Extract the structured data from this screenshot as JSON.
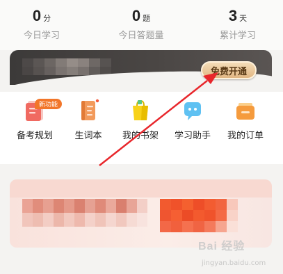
{
  "stats": [
    {
      "value": "0",
      "unit": "分",
      "label": "今日学习"
    },
    {
      "value": "0",
      "unit": "题",
      "label": "今日答题量"
    },
    {
      "value": "3",
      "unit": "天",
      "label": "累计学习"
    }
  ],
  "vip": {
    "button_label": "免费开通"
  },
  "tools": {
    "new_badge": "新功能",
    "items": [
      {
        "label": "备考规划",
        "icon": "plan-note-icon"
      },
      {
        "label": "生词本",
        "icon": "vocab-book-icon"
      },
      {
        "label": "我的书架",
        "icon": "bookshelf-bag-icon"
      },
      {
        "label": "学习助手",
        "icon": "assistant-chat-icon"
      },
      {
        "label": "我的订单",
        "icon": "order-wallet-icon"
      }
    ]
  },
  "watermark": {
    "logo": "Bai 经验",
    "url": "jingyan.baidu.com"
  },
  "colors": {
    "accent": "#f2762a",
    "arrow": "#e8262b",
    "vip_bg": "#3c3a39",
    "vip_button": "#e1b683"
  }
}
